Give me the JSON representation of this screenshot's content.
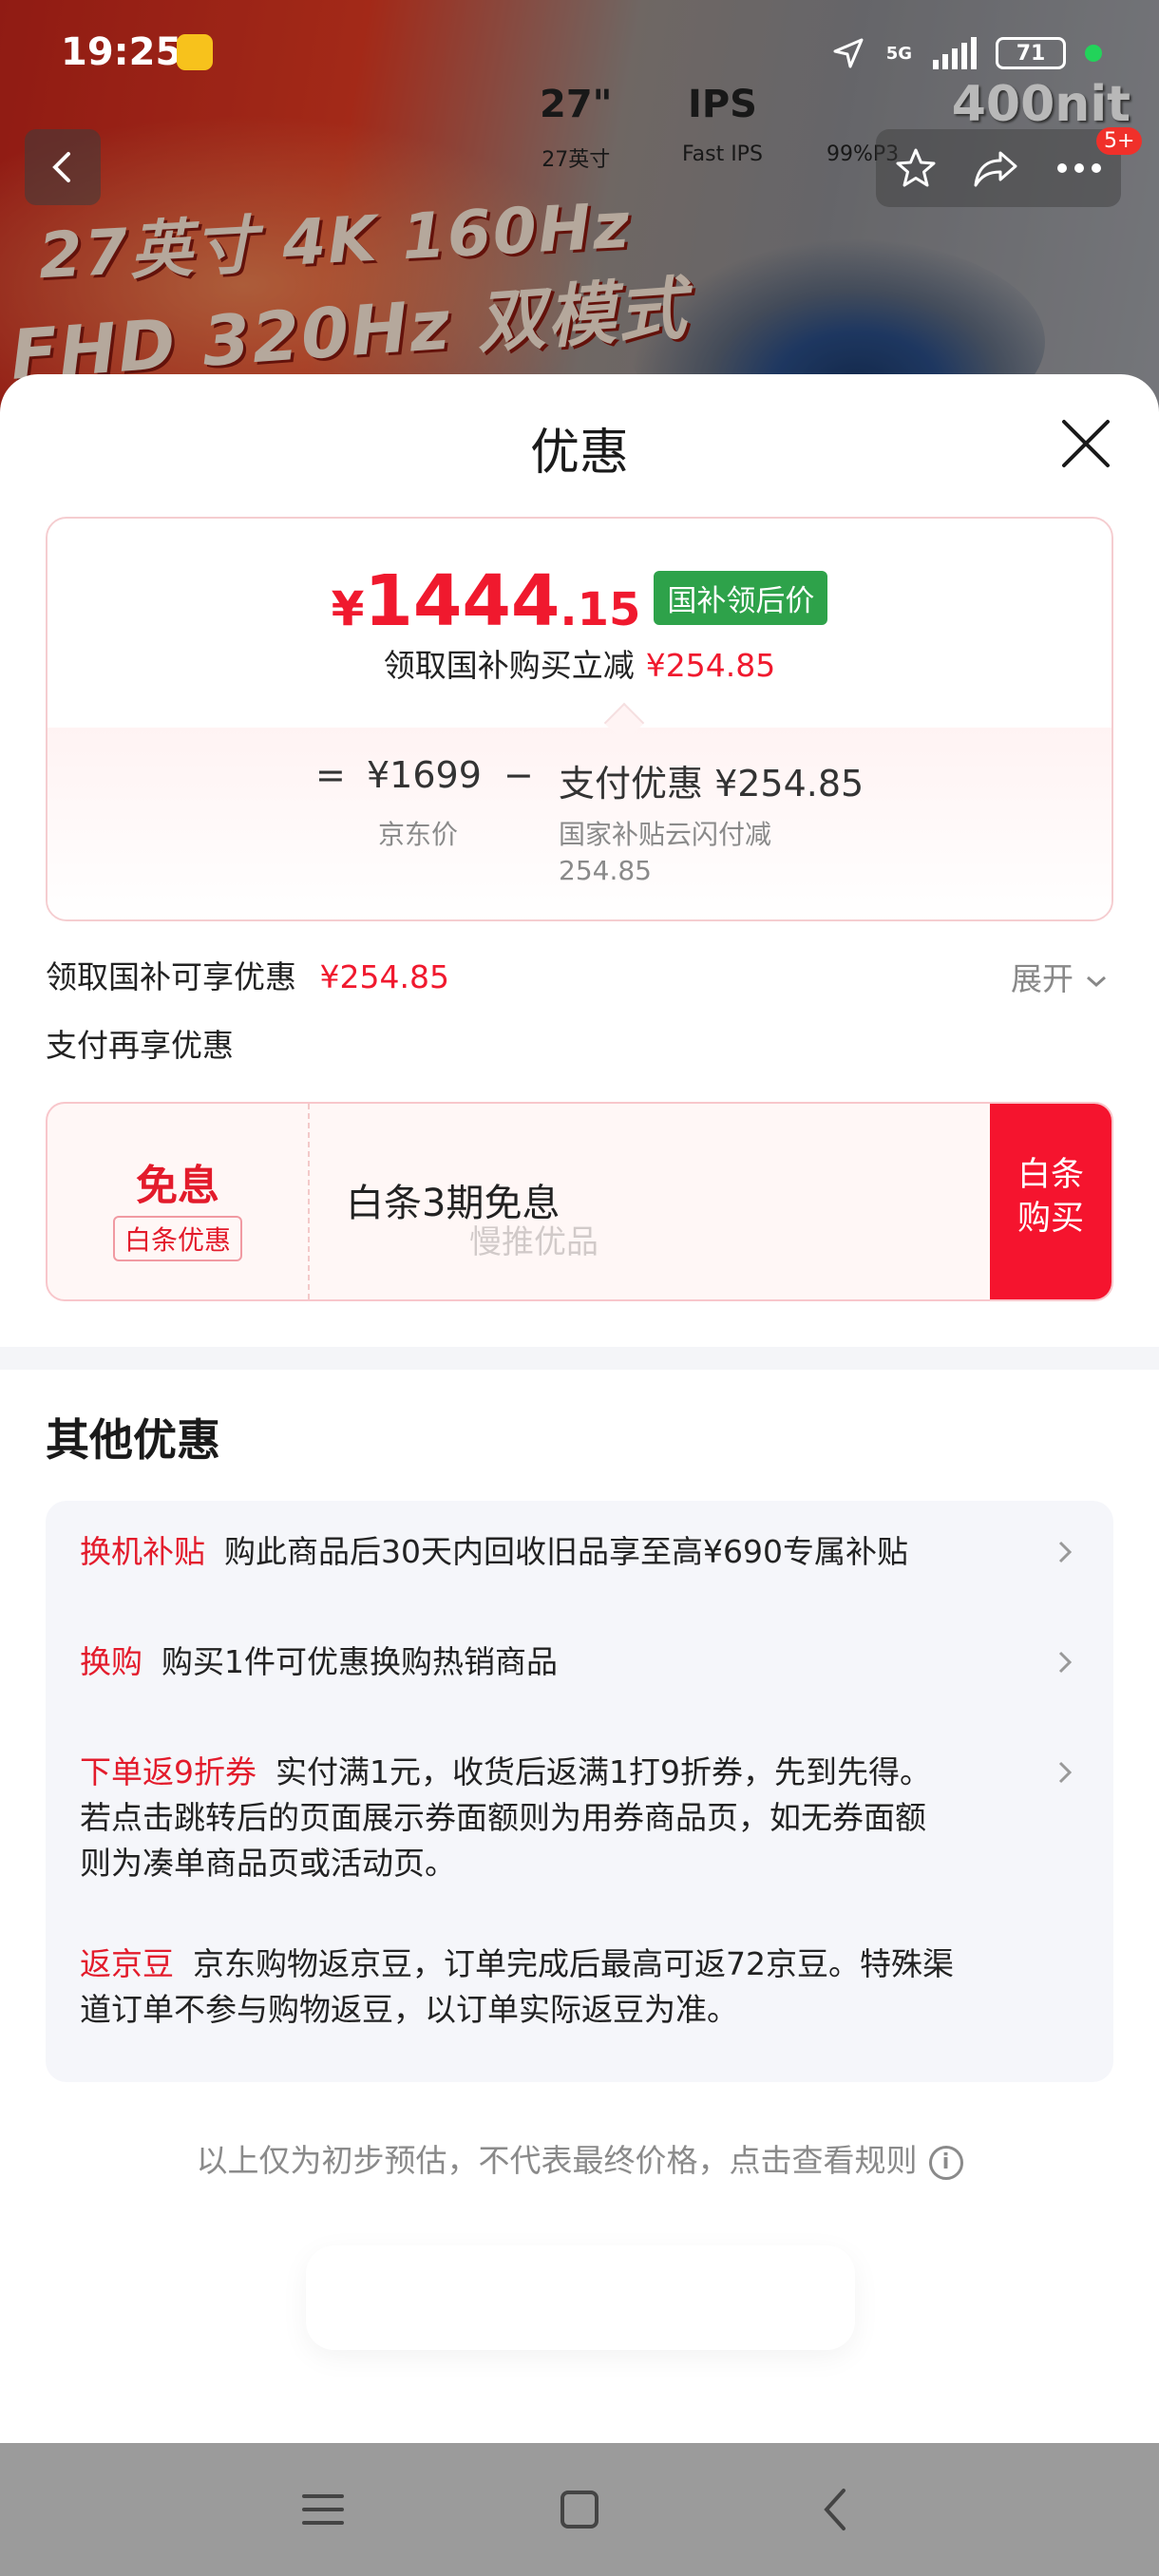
{
  "status": {
    "time": "19:25",
    "network": "5G",
    "battery": "71"
  },
  "banner": {
    "line1": "27英寸 4K 160Hz",
    "line2": "FHD 320Hz 双模式",
    "specs": [
      {
        "big": "27\"",
        "caption": "27英寸"
      },
      {
        "big": "IPS",
        "caption": "Fast IPS"
      },
      {
        "big": "",
        "caption": "99%P3"
      }
    ],
    "brightness": "400nit",
    "badge": "5+"
  },
  "sheet": {
    "title": "优惠"
  },
  "price_card": {
    "currency": "¥",
    "price_int": "1444",
    "price_dec": ".15",
    "price_tag": "国补领后价",
    "subtitle": "领取国补购买立减",
    "subtitle_amount": "¥254.85",
    "eq": "=",
    "jd_price": "¥1699",
    "minus": "−",
    "pay_discount": "支付优惠 ¥254.85",
    "jd_price_caption": "京东价",
    "pay_caption_line1": "国家补贴云闪付减",
    "pay_caption_line2": "254.85"
  },
  "subsidy_line": {
    "label": "领取国补可享优惠",
    "amount": "¥254.85",
    "expand": "展开"
  },
  "pay_more": {
    "label": "支付再享优惠"
  },
  "baitiao": {
    "big": "免息",
    "pill": "白条优惠",
    "title": "白条3期免息",
    "watermark": "慢推优品",
    "button_line1": "白条",
    "button_line2": "购买"
  },
  "other": {
    "title": "其他优惠",
    "items": [
      {
        "label": "换机补贴",
        "text": "购此商品后30天内回收旧品享至高¥690专属补贴"
      },
      {
        "label": "换购",
        "text": "购买1件可优惠换购热销商品"
      },
      {
        "label": "下单返9折券",
        "text": "实付满1元，收货后返满1打9折券，先到先得。",
        "text2": "若点击跳转后的页面展示券面额则为用券商品页，如无券面额",
        "text3": "则为凑单商品页或活动页。"
      },
      {
        "label": "返京豆",
        "text": "京东购物返京豆，订单完成后最高可返72京豆。特殊渠",
        "text2": "道订单不参与购物返豆，以订单实际返豆为准。"
      }
    ]
  },
  "footnote": {
    "text": "以上仅为初步预估，不代表最终价格，点击查看规则",
    "info": "i"
  },
  "colors": {
    "accent_red": "#f0192e",
    "tag_green": "#2ea24a"
  }
}
